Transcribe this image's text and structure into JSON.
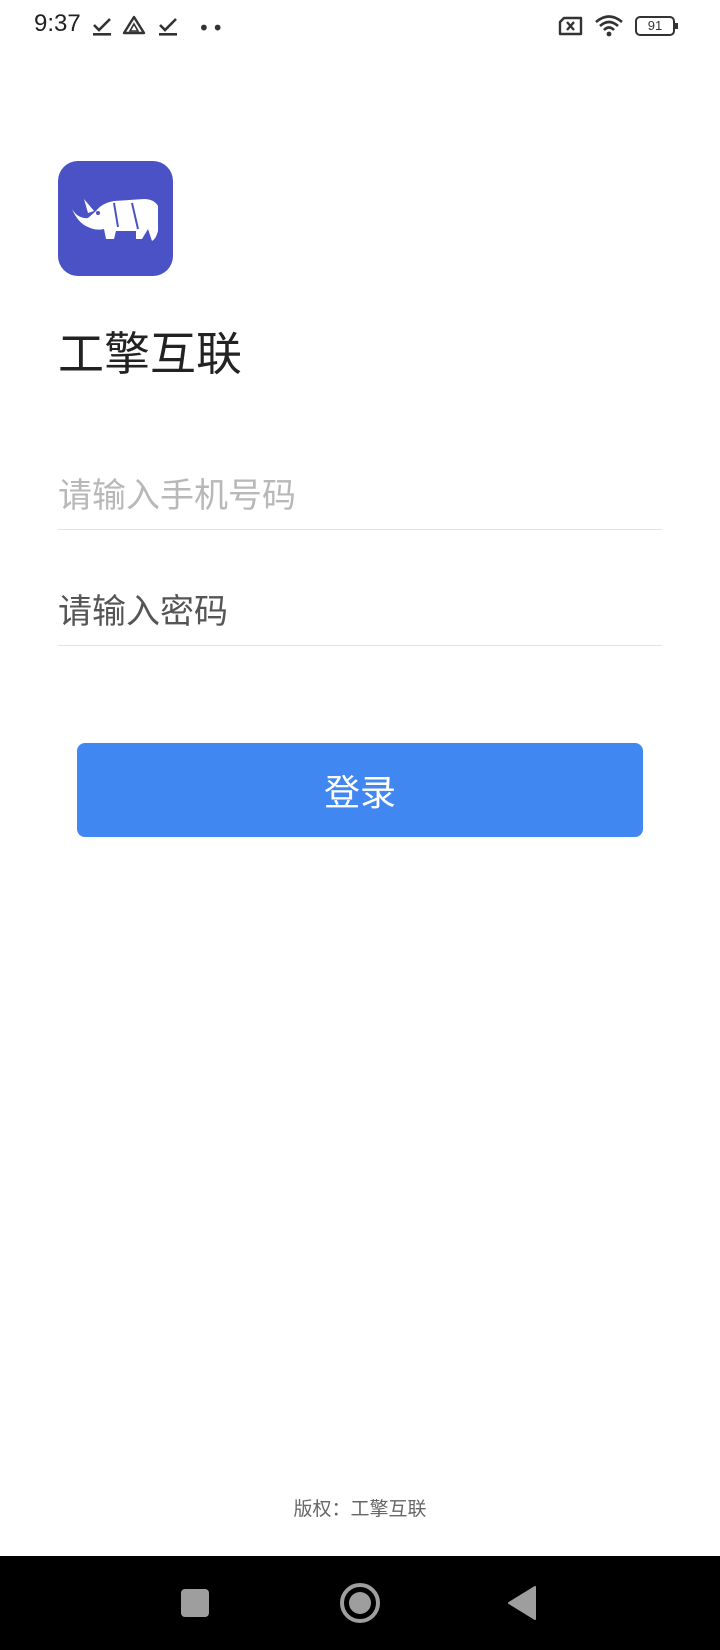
{
  "status_bar": {
    "time": "9:37",
    "battery": "91",
    "icons": [
      "check-download-icon",
      "drive-icon",
      "check-download-icon",
      "more-dots-icon",
      "no-sim-icon",
      "wifi-icon",
      "battery-icon"
    ]
  },
  "app": {
    "title": "工擎互联",
    "logo_icon": "rhino-logo-icon",
    "brand_color": "#4b52c6"
  },
  "login_form": {
    "phone_placeholder": "请输入手机号码",
    "password_placeholder": "请输入密码",
    "submit_label": "登录",
    "button_color": "#4187f2"
  },
  "footer": {
    "copyright": "版权：工擎互联"
  },
  "nav_bar": {
    "buttons": [
      "recents-square-icon",
      "home-circle-icon",
      "back-triangle-icon"
    ]
  }
}
